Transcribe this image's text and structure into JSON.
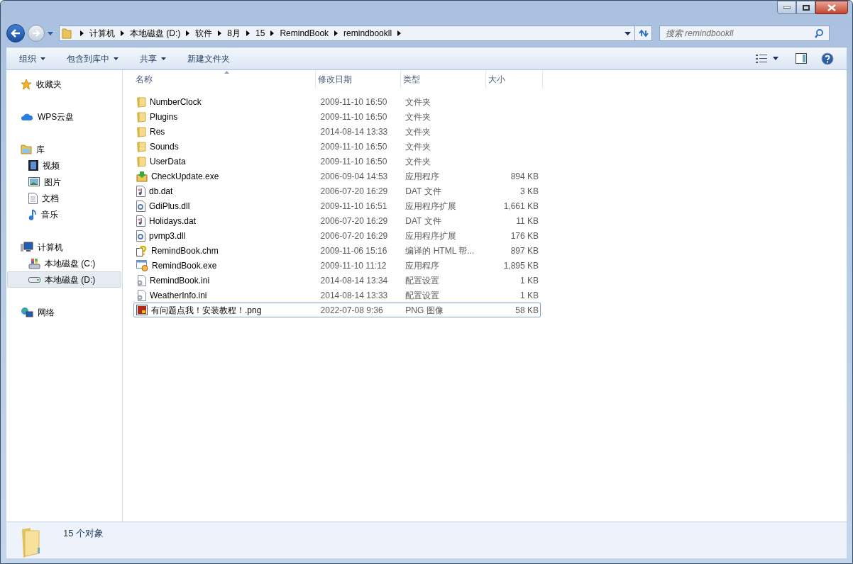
{
  "address_bar": {
    "segments": [
      "计算机",
      "本地磁盘 (D:)",
      "软件",
      "8月",
      "15",
      "RemindBook",
      "remindbookll"
    ]
  },
  "search": {
    "placeholder": "搜索 remindbookll"
  },
  "toolbar": {
    "buttons": [
      {
        "label": "组织",
        "has_menu": true
      },
      {
        "label": "包含到库中",
        "has_menu": true
      },
      {
        "label": "共享",
        "has_menu": true
      },
      {
        "label": "新建文件夹",
        "has_menu": false
      }
    ]
  },
  "sidebar": {
    "groups": [
      {
        "label": "收藏夹",
        "kind": "star",
        "selected": false
      },
      {
        "label": "WPS云盘",
        "kind": "cloud",
        "selected": false
      },
      {
        "label": "库",
        "kind": "library",
        "selected": false,
        "children": [
          {
            "label": "视频",
            "kind": "video",
            "selected": false
          },
          {
            "label": "图片",
            "kind": "picture",
            "selected": false
          },
          {
            "label": "文档",
            "kind": "document",
            "selected": false
          },
          {
            "label": "音乐",
            "kind": "music",
            "selected": false
          }
        ]
      },
      {
        "label": "计算机",
        "kind": "computer",
        "selected": false,
        "children": [
          {
            "label": "本地磁盘 (C:)",
            "kind": "system-drive",
            "selected": false
          },
          {
            "label": "本地磁盘 (D:)",
            "kind": "drive",
            "selected": true
          }
        ]
      },
      {
        "label": "网络",
        "kind": "network",
        "selected": false
      }
    ]
  },
  "table": {
    "columns": [
      {
        "label": "名称",
        "sorted": true
      },
      {
        "label": "修改日期",
        "sorted": false
      },
      {
        "label": "类型",
        "sorted": false
      },
      {
        "label": "大小",
        "sorted": false
      }
    ],
    "rows": [
      {
        "kind": "folder",
        "name": "NumberClock",
        "date": "2009-11-10 16:50",
        "type": "文件夹",
        "focused": false
      },
      {
        "kind": "folder",
        "name": "Plugins",
        "date": "2009-11-10 16:50",
        "type": "文件夹",
        "focused": false
      },
      {
        "kind": "folder",
        "name": "Res",
        "date": "2014-08-14 13:33",
        "type": "文件夹",
        "focused": false
      },
      {
        "kind": "folder",
        "name": "Sounds",
        "date": "2009-11-10 16:50",
        "type": "文件夹",
        "focused": false
      },
      {
        "kind": "folder",
        "name": "UserData",
        "date": "2009-11-10 16:50",
        "type": "文件夹",
        "focused": false
      },
      {
        "kind": "installer",
        "name": "CheckUpdate.exe",
        "date": "2006-09-04 14:53",
        "type": "应用程序",
        "size": "894 KB",
        "focused": false
      },
      {
        "kind": "media",
        "name": "db.dat",
        "date": "2006-07-20 16:29",
        "type": "DAT 文件",
        "size": "3 KB",
        "focused": false
      },
      {
        "kind": "dll",
        "name": "GdiPlus.dll",
        "date": "2009-11-10 16:51",
        "type": "应用程序扩展",
        "size": "1,661 KB",
        "focused": false
      },
      {
        "kind": "media",
        "name": "Holidays.dat",
        "date": "2006-07-20 16:29",
        "type": "DAT 文件",
        "size": "11 KB",
        "focused": false
      },
      {
        "kind": "dll",
        "name": "pvmp3.dll",
        "date": "2006-07-20 16:29",
        "type": "应用程序扩展",
        "size": "176 KB",
        "focused": false
      },
      {
        "kind": "help",
        "name": "RemindBook.chm",
        "date": "2009-11-06 15:16",
        "type": "编译的 HTML 帮...",
        "size": "897 KB",
        "focused": false
      },
      {
        "kind": "app",
        "name": "RemindBook.exe",
        "date": "2009-11-10 11:12",
        "type": "应用程序",
        "size": "1,895 KB",
        "focused": false
      },
      {
        "kind": "settings",
        "name": "RemindBook.ini",
        "date": "2014-08-14 13:34",
        "type": "配置设置",
        "size": "1 KB",
        "focused": false
      },
      {
        "kind": "settings",
        "name": "WeatherInfo.ini",
        "date": "2014-08-14 13:33",
        "type": "配置设置",
        "size": "1 KB",
        "focused": false
      },
      {
        "kind": "image",
        "name": "有问题点我！安装教程！.png",
        "date": "2022-07-08 9:36",
        "type": "PNG 图像",
        "size": "58 KB",
        "focused": true
      }
    ]
  },
  "status_bar": {
    "text": "15 个对象"
  }
}
